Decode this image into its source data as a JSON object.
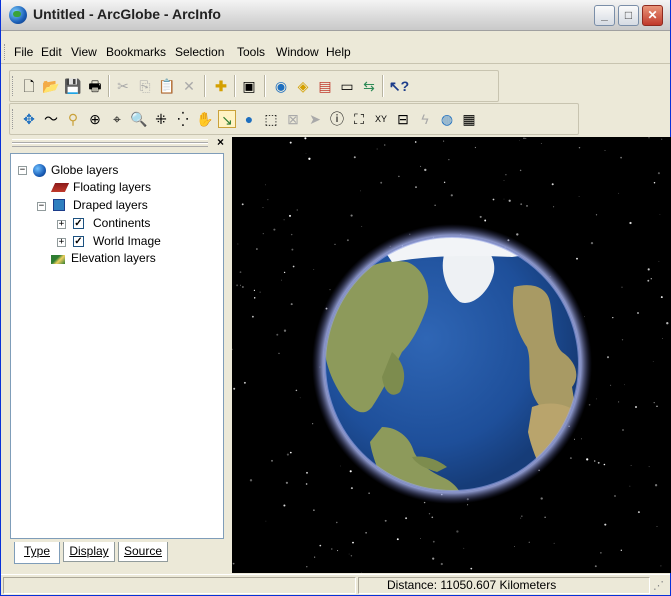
{
  "window": {
    "title": "Untitled - ArcGlobe - ArcInfo",
    "minimize_label": "_",
    "maximize_label": "□",
    "close_label": "✕"
  },
  "menu": [
    "File",
    "Edit",
    "View",
    "Bookmarks",
    "Selection",
    "Tools",
    "Window",
    "Help"
  ],
  "standard_toolbar": [
    "new-document-icon",
    "open-folder-icon",
    "save-icon",
    "print-icon",
    "cut-icon",
    "copy-icon",
    "paste-icon",
    "delete-icon",
    "add-data-icon",
    "layout-icon",
    "globe-catalog-icon",
    "arc-catalog-icon",
    "arc-toolbox-icon",
    "window-icon",
    "model-builder-icon",
    "whats-this-icon"
  ],
  "tools_toolbar": [
    "navigate-icon",
    "fly-icon",
    "center-on-target-icon",
    "zoom-to-target-icon",
    "set-observer-icon",
    "zoom-in-out-icon",
    "fixed-zoom-in-icon",
    "fixed-zoom-out-icon",
    "pan-icon",
    "full-extent-icon",
    "globe-icon",
    "select-features-icon",
    "clear-selection-icon",
    "select-elements-icon",
    "identify-icon",
    "find-icon",
    "go-to-xy-icon",
    "measure-icon",
    "hyperlink-icon",
    "globe-bookmark-icon",
    "properties-icon"
  ],
  "toc": {
    "close_label": "×",
    "tree": {
      "root": "Globe layers",
      "floating": "Floating layers",
      "draped": "Draped layers",
      "continents": "Continents",
      "world_image": "World Image",
      "elevation": "Elevation layers"
    },
    "tabs": [
      "Type",
      "Display",
      "Source"
    ]
  },
  "status": {
    "distance": "Distance:  11050.607 Kilometers"
  },
  "colors": {
    "space": "#000000",
    "ocean": "#1e4f9a",
    "land": "#8d9a5b",
    "ice": "#f2f4f7"
  }
}
